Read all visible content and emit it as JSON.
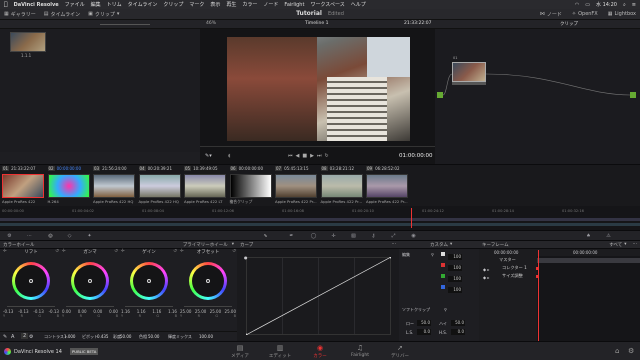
{
  "menubar": {
    "app": "DaVinci Resolve",
    "items": [
      "ファイル",
      "編集",
      "トリム",
      "タイムライン",
      "クリップ",
      "マーク",
      "表示",
      "再生",
      "カラー",
      "ノード",
      "Fairlight",
      "ワークスペース",
      "ヘルプ"
    ],
    "clock": "水 14:20"
  },
  "toolbar": {
    "gallery": "ギャラリー",
    "timeline": "タイムライン",
    "clip": "クリップ",
    "title": "Tutorial",
    "status": "Edited",
    "node": "ノード",
    "openfx": "OpenFX",
    "lightbox": "Lightbox"
  },
  "viewer": {
    "zoom": "46%",
    "timeline_name": "Timeline 1",
    "timecode_top": "21:33:22:07",
    "timecode": "01:00:00:00"
  },
  "gallery_still": {
    "label": "1.1.1"
  },
  "nodegraph": {
    "node_number": "01",
    "right_menu": "クリップ"
  },
  "clips": [
    {
      "num": "01",
      "tc": "21:33:22:07",
      "codec": "Apple ProRes 422"
    },
    {
      "num": "02",
      "tc": "00:00:00:00",
      "codec": "H.264"
    },
    {
      "num": "03",
      "tc": "21:56:24:00",
      "codec": "Apple ProRes 422 HQ"
    },
    {
      "num": "04",
      "tc": "00:20:39:21",
      "codec": "Apple ProRes 422 HQ"
    },
    {
      "num": "05",
      "tc": "10:39:49:05",
      "codec": "Apple ProRes 422 LT"
    },
    {
      "num": "06",
      "tc": "00:00:00:00",
      "codec": "複合クリップ"
    },
    {
      "num": "07",
      "tc": "05:45:13:15",
      "codec": "Apple ProRes 422 Pr..."
    },
    {
      "num": "08",
      "tc": "03:28:21:12",
      "codec": "Apple ProRes 422 Pr..."
    },
    {
      "num": "09",
      "tc": "06:28:52:02",
      "codec": "Apple ProRes 422 Pr..."
    }
  ],
  "ruler": [
    "00:00:00:00",
    "01:00:04:02",
    "01:00:08:04",
    "01:00:12:06",
    "01:00:16:08",
    "01:00:20:10",
    "01:00:24:12",
    "01:00:28:14",
    "01:00:32:16"
  ],
  "panels": {
    "colorwheels": "カラーホイール",
    "primary": "プライマリーホイール",
    "curves": "カーブ",
    "custom": "カスタム",
    "keyframes": "キーフレーム",
    "all": "すべて"
  },
  "wheels": [
    {
      "name": "リフト",
      "vals": [
        "-0.13",
        "-0.13",
        "-0.13",
        "-0.13"
      ]
    },
    {
      "name": "ガンマ",
      "vals": [
        "0.00",
        "0.00",
        "0.00",
        "0.00"
      ]
    },
    {
      "name": "ゲイン",
      "vals": [
        "1.16",
        "1.16",
        "1.16",
        "1.16"
      ]
    },
    {
      "name": "オフセット",
      "vals": [
        "25.00",
        "25.00",
        "25.00",
        "25.00"
      ]
    }
  ],
  "wheel_channels": [
    "Y",
    "R",
    "G",
    "B"
  ],
  "adjust": {
    "page": "2",
    "contrast_label": "コントラスト",
    "contrast": "1.000",
    "pivot_label": "ピボット",
    "pivot": "0.435",
    "sat_label": "彩度",
    "sat": "50.00",
    "hue_label": "色相",
    "hue": "50.00",
    "lummix_label": "輝度ミックス",
    "lummix": "100.00"
  },
  "custom": {
    "edit": "編集",
    "rows": [
      "100",
      "100",
      "100",
      "100"
    ],
    "softclip": "ソフトクリップ",
    "low": "ロー",
    "low_val": "50.0",
    "high": "ハイ",
    "high_val": "50.0",
    "ls": "L.S.",
    "ls_val": "0.0",
    "hs": "H.S.",
    "hs_val": "0.0"
  },
  "kf": {
    "tc": "00:00:00:00",
    "tc2": "00:00:00:00",
    "master": "マスター",
    "row1": "コレクター 1",
    "row2": "サイズ調整"
  },
  "bottom": {
    "app": "DaVinci Resolve 14",
    "beta": "PUBLIC BETA",
    "nav": [
      "メディア",
      "エディット",
      "カラー",
      "Fairlight",
      "デリバー"
    ]
  }
}
